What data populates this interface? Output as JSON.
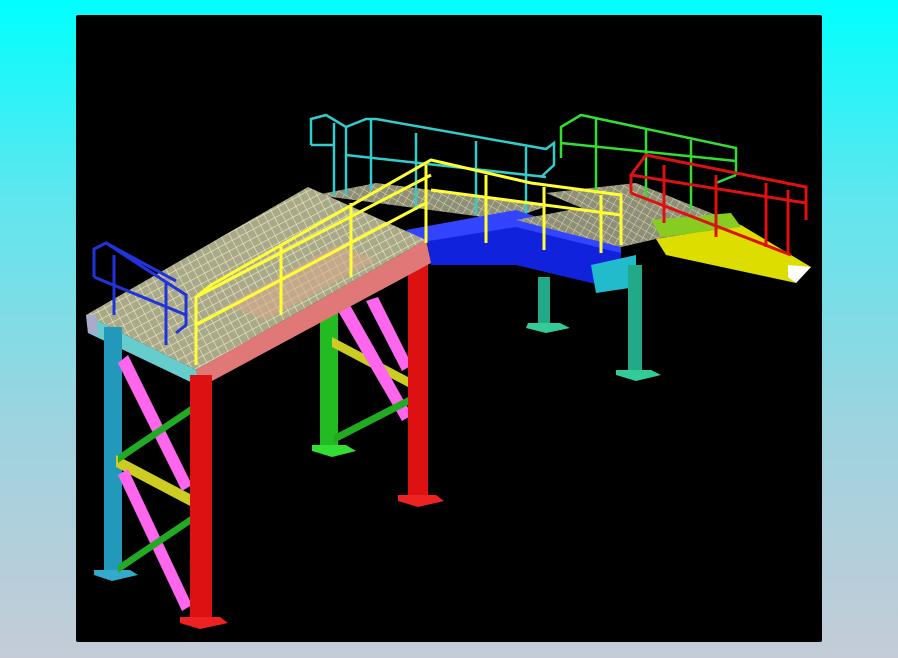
{
  "scene": {
    "background": "#000000",
    "colors": {
      "grating": "#c8c89a",
      "grating_lines": "#7a7a66",
      "handrail_yellow": "#ffff33",
      "handrail_cyan": "#33cccc",
      "handrail_green": "#33dd33",
      "handrail_red": "#dd1111",
      "handrail_blue": "#2233dd",
      "beam_pink": "#e07878",
      "beam_blue": "#1122dd",
      "beam_yellow": "#e6e600",
      "column_red": "#dd1111",
      "column_cyan": "#2299bb",
      "column_green": "#22bb22",
      "column_teal": "#22aa88",
      "brace_magenta": "#ff66ee",
      "brace_yellow": "#cccc22"
    }
  }
}
